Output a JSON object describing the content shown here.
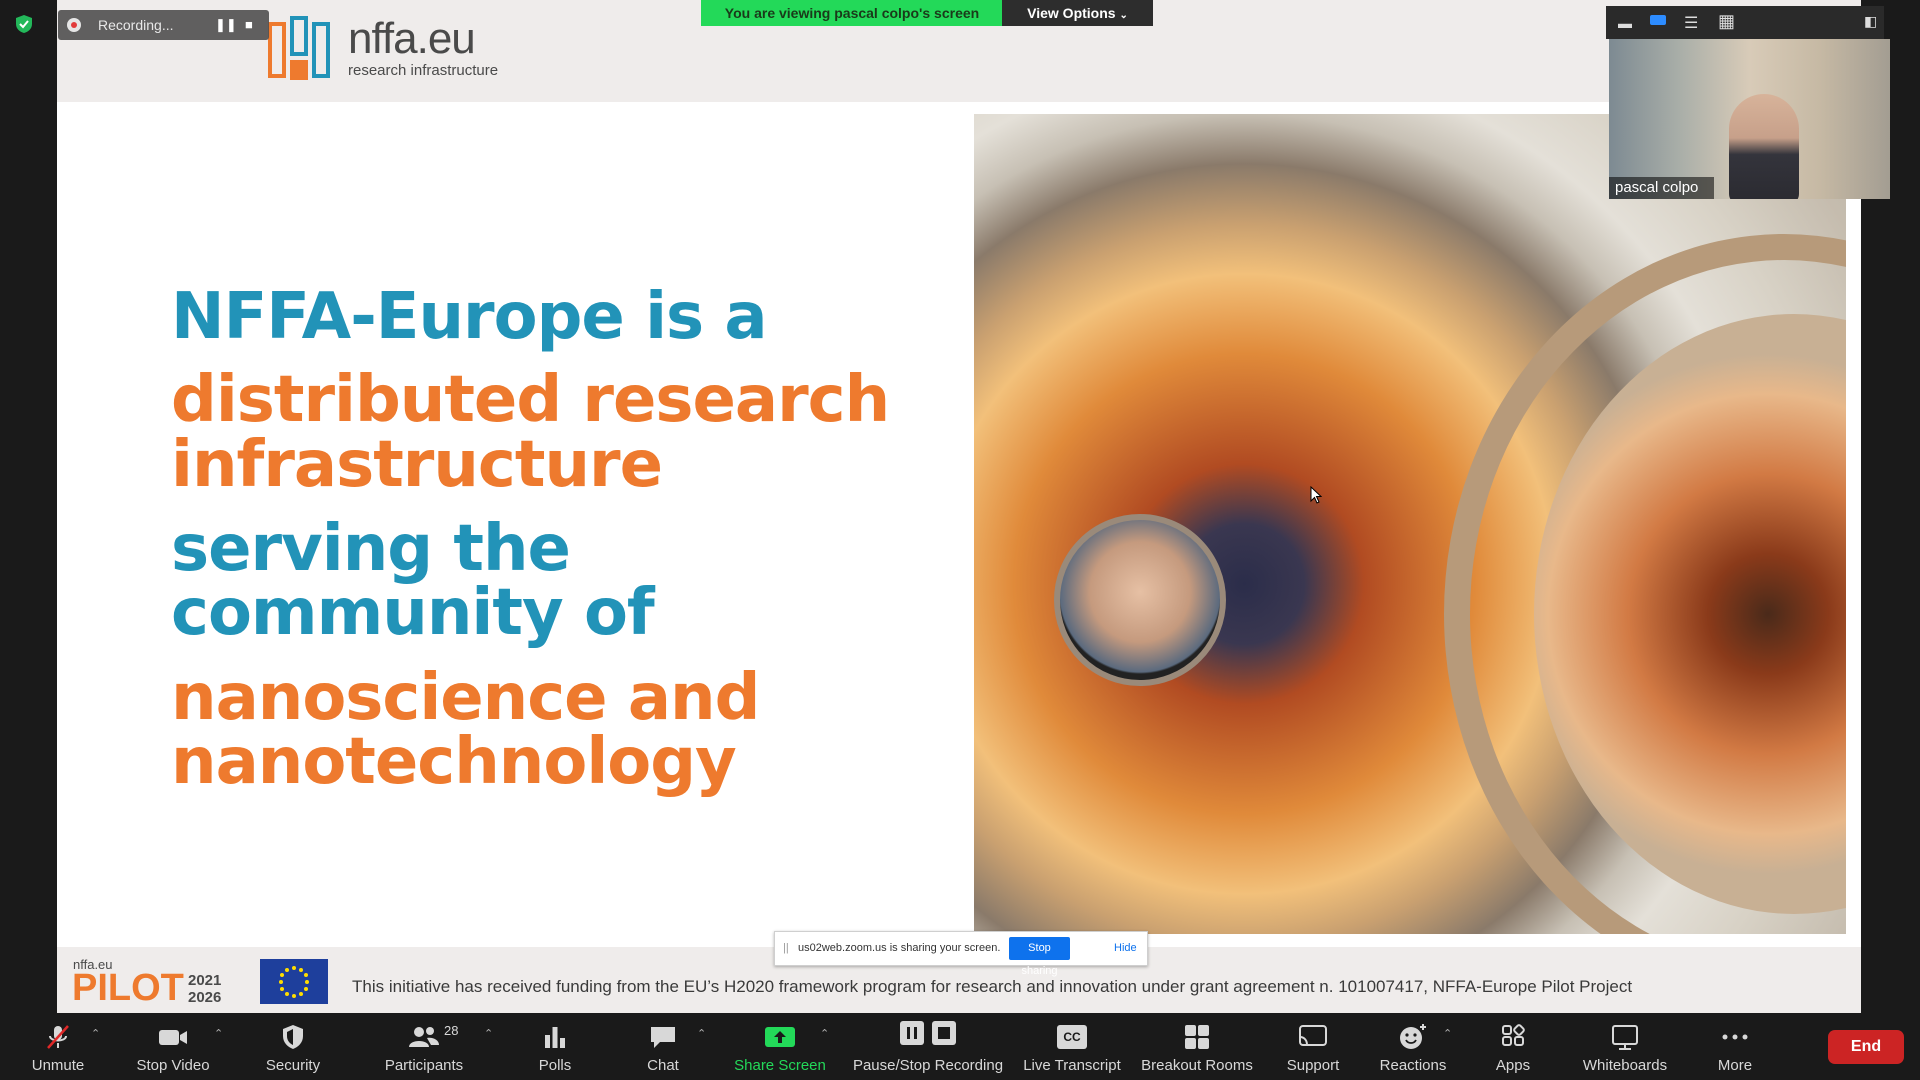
{
  "banner": {
    "viewing_text": "You are viewing pascal colpo's screen",
    "view_options_label": "View Options"
  },
  "recording": {
    "label": "Recording..."
  },
  "slide": {
    "logo_text": "nffa.eu",
    "logo_subtext": "research infrastructure",
    "headline_line1": "NFFA-Europe is a",
    "headline_line2": "distributed research",
    "headline_line3": "infrastructure",
    "headline_line4": "serving the",
    "headline_line5": "community of",
    "headline_line6": "nanoscience and",
    "headline_line7": "nanotechnology",
    "footer": {
      "pilot_small": "nffa.eu",
      "pilot_label": "PILOT",
      "pilot_year_start": "2021",
      "pilot_year_end": "2026",
      "funding_text": "This initiative has received funding from the EU’s H2020 framework program  for research and innovation under grant agreement n. 101007417, NFFA-Europe Pilot Project"
    }
  },
  "share_notice": {
    "message": "us02web.zoom.us is sharing your screen.",
    "stop_label": "Stop sharing",
    "hide_label": "Hide"
  },
  "participant_video": {
    "name": "pascal colpo"
  },
  "toolbar": {
    "unmute": "Unmute",
    "stop_video": "Stop Video",
    "security": "Security",
    "participants": "Participants",
    "participants_count": "28",
    "polls": "Polls",
    "chat": "Chat",
    "share_screen": "Share Screen",
    "pause_stop_recording": "Pause/Stop Recording",
    "live_transcript": "Live Transcript",
    "cc_icon_text": "CC",
    "breakout_rooms": "Breakout Rooms",
    "support": "Support",
    "reactions": "Reactions",
    "apps": "Apps",
    "whiteboards": "Whiteboards",
    "more": "More",
    "end": "End"
  },
  "colors": {
    "accent_blue": "#2293b8",
    "accent_orange": "#ee7a2e",
    "share_green": "#23d959",
    "end_red": "#cc2424"
  }
}
